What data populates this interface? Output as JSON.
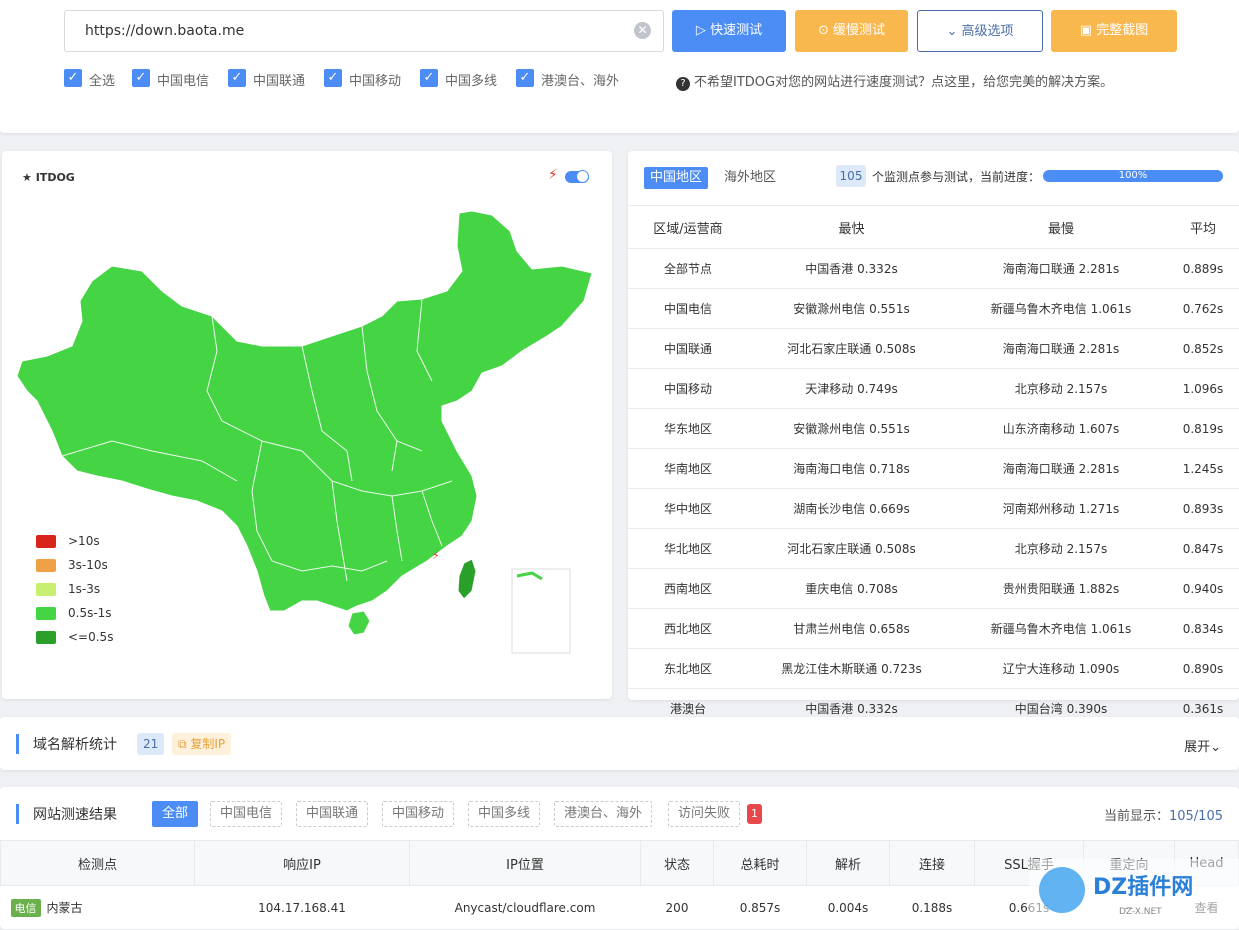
{
  "top": {
    "url": "https://down.baota.me",
    "buttons": {
      "quick": "快速测试",
      "slow": "缓慢测试",
      "advanced": "高级选项",
      "screenshot": "完整截图"
    },
    "checks": [
      "全选",
      "中国电信",
      "中国联通",
      "中国移动",
      "中国多线",
      "港澳台、海外"
    ],
    "notice": "不希望ITDOG对您的网站进行速度测试？点这里，给您完美的解决方案。"
  },
  "map": {
    "logo": "ITDOG",
    "legend": [
      {
        "label": ">10s",
        "color": "#d9241c"
      },
      {
        "label": "3s-10s",
        "color": "#f0a046"
      },
      {
        "label": "1s-3s",
        "color": "#c8f070"
      },
      {
        "label": "0.5s-1s",
        "color": "#44d444"
      },
      {
        "label": "<=0.5s",
        "color": "#2aa02a"
      }
    ]
  },
  "stats": {
    "tab_china": "中国地区",
    "tab_overseas": "海外地区",
    "count": "105",
    "count_text": "个监测点参与测试，当前进度：",
    "progress_label": "100%",
    "progress": 1.0,
    "headers": [
      "区域/运营商",
      "最快",
      "最慢",
      "平均"
    ],
    "rows": [
      [
        "全部节点",
        "中国香港 0.332s",
        "海南海口联通 2.281s",
        "0.889s"
      ],
      [
        "中国电信",
        "安徽滁州电信 0.551s",
        "新疆乌鲁木齐电信 1.061s",
        "0.762s"
      ],
      [
        "中国联通",
        "河北石家庄联通 0.508s",
        "海南海口联通 2.281s",
        "0.852s"
      ],
      [
        "中国移动",
        "天津移动 0.749s",
        "北京移动 2.157s",
        "1.096s"
      ],
      [
        "华东地区",
        "安徽滁州电信 0.551s",
        "山东济南移动 1.607s",
        "0.819s"
      ],
      [
        "华南地区",
        "海南海口电信 0.718s",
        "海南海口联通 2.281s",
        "1.245s"
      ],
      [
        "华中地区",
        "湖南长沙电信 0.669s",
        "河南郑州移动 1.271s",
        "0.893s"
      ],
      [
        "华北地区",
        "河北石家庄联通 0.508s",
        "北京移动 2.157s",
        "0.847s"
      ],
      [
        "西南地区",
        "重庆电信 0.708s",
        "贵州贵阳联通 1.882s",
        "0.940s"
      ],
      [
        "西北地区",
        "甘肃兰州电信 0.658s",
        "新疆乌鲁木齐电信 1.061s",
        "0.834s"
      ],
      [
        "东北地区",
        "黑龙江佳木斯联通 0.723s",
        "辽宁大连移动 1.090s",
        "0.890s"
      ],
      [
        "港澳台",
        "中国香港 0.332s",
        "中国台湾 0.390s",
        "0.361s"
      ]
    ]
  },
  "dns": {
    "title": "域名解析统计",
    "count": "21",
    "copy": "复制IP",
    "expand": "展开"
  },
  "results": {
    "title": "网站测速结果",
    "filters": [
      "全部",
      "中国电信",
      "中国联通",
      "中国移动",
      "中国多线",
      "港澳台、海外",
      "访问失败"
    ],
    "fail_count": "1",
    "shown_label": "当前显示：",
    "shown_num": "105",
    "shown_total": "/105",
    "headers": [
      "检测点",
      "响应IP",
      "IP位置",
      "状态",
      "总耗时",
      "解析",
      "连接",
      "SSL握手",
      "重定向",
      "Head"
    ],
    "row": {
      "isp": "电信",
      "node": "内蒙古",
      "ip": "104.17.168.41",
      "location": "Anycast/cloudflare.com",
      "status": "200",
      "total": "0.857s",
      "dns": "0.004s",
      "connect": "0.188s",
      "ssl": "0.661s",
      "redirect": "--",
      "head": "查看"
    }
  },
  "watermark": {
    "main": "DZ插件网",
    "sub": "DZ-X.NET"
  }
}
